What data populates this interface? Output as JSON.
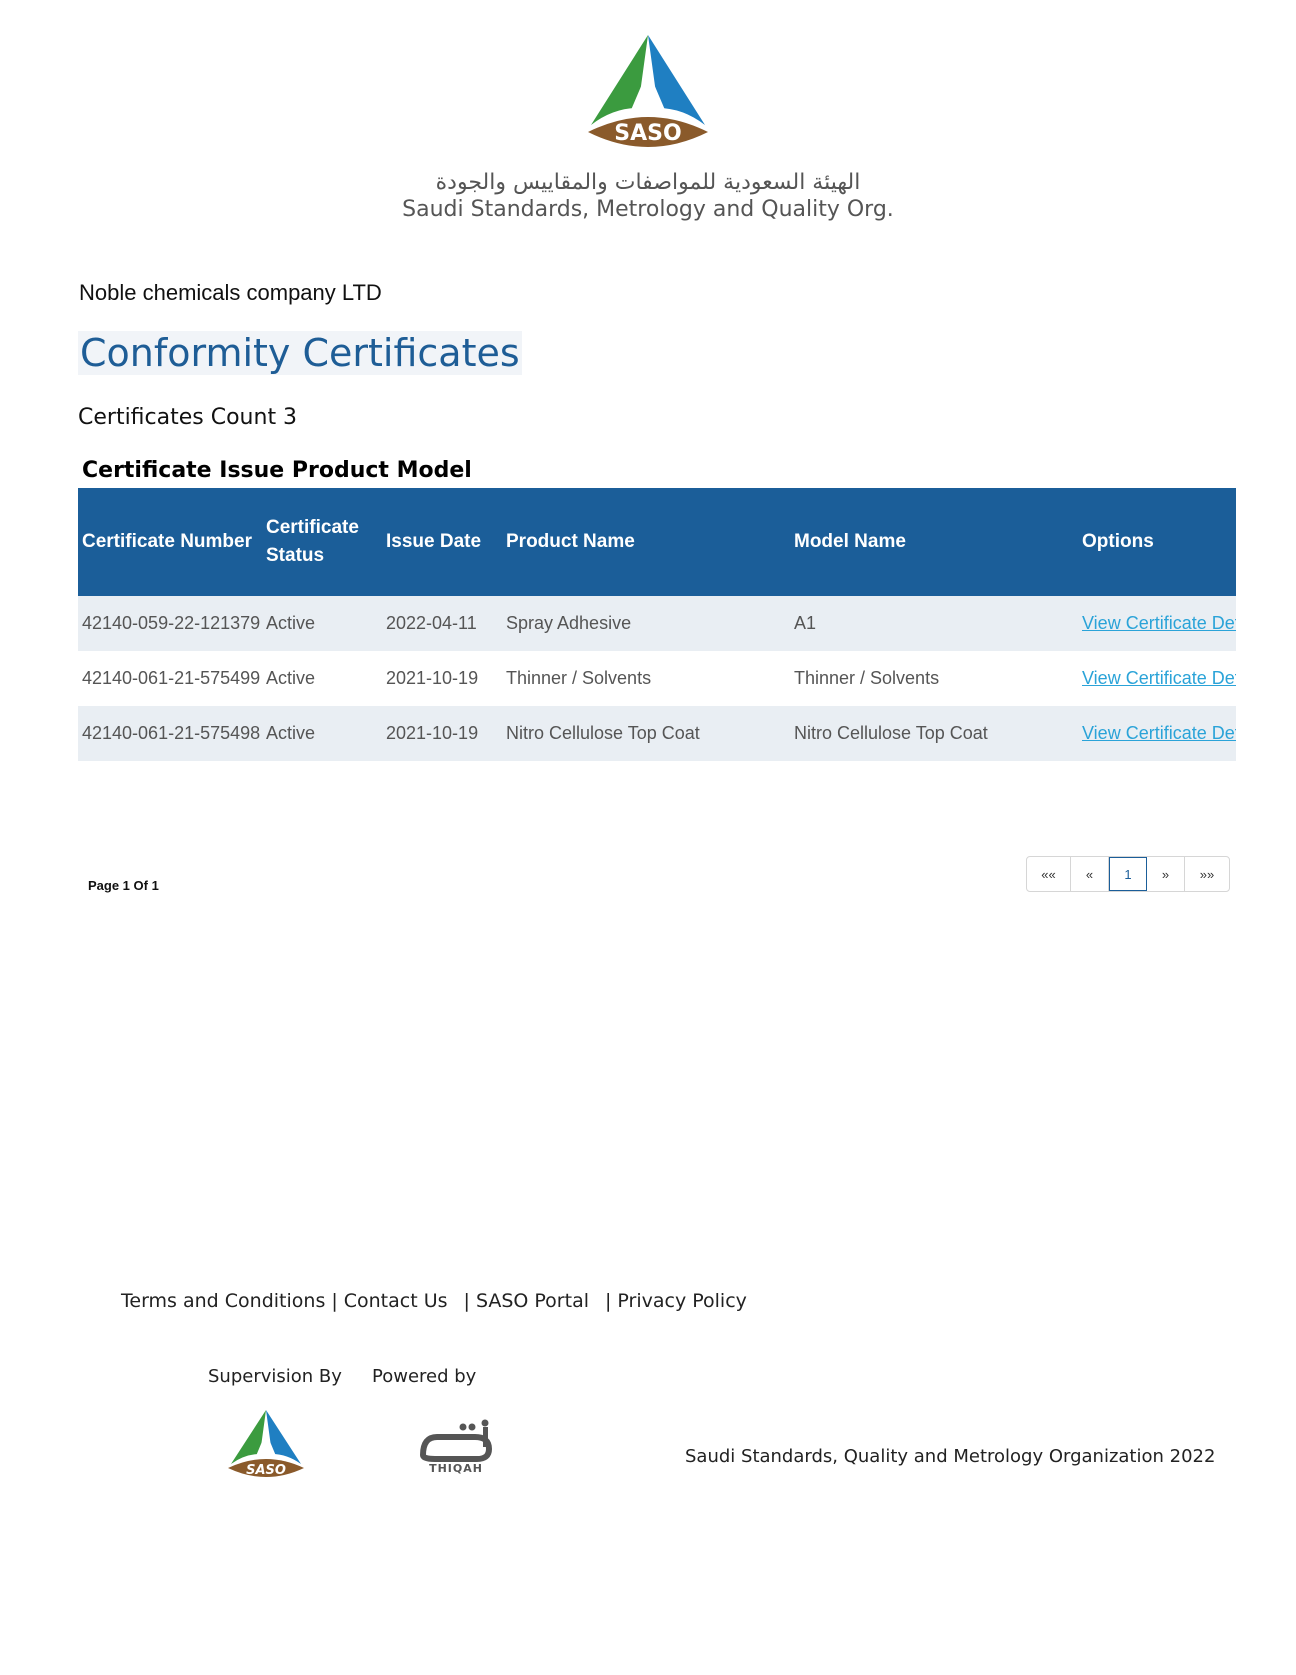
{
  "header": {
    "logo_text": "SASO",
    "org_name_arabic": "الهيئة السعودية للمواصفات والمقاييس والجودة",
    "org_name_english": "Saudi Standards, Metrology and Quality Org."
  },
  "company_name": "Noble chemicals company LTD",
  "page_title": "Conformity Certificates",
  "certificates_count": "Certificates Count 3",
  "table": {
    "caption": "Certificate Issue Product Model",
    "headers": {
      "certificate_number": "Certificate Number",
      "certificate_status": "Certificate Status",
      "issue_date": "Issue Date",
      "product_name": "Product Name",
      "model_name": "Model Name",
      "options": "Options"
    },
    "rows": [
      {
        "certificate_number": "42140-059-22-121379",
        "status": "Active",
        "issue_date": "2022-04-11",
        "product_name": "Spray Adhesive",
        "model_name": "A1",
        "option": "View Certificate Details"
      },
      {
        "certificate_number": "42140-061-21-575499",
        "status": "Active",
        "issue_date": "2021-10-19",
        "product_name": "Thinner / Solvents",
        "model_name": "Thinner / Solvents",
        "option": "View Certificate Details"
      },
      {
        "certificate_number": "42140-061-21-575498",
        "status": "Active",
        "issue_date": "2021-10-19",
        "product_name": "Nitro Cellulose Top Coat",
        "model_name": "Nitro Cellulose Top Coat",
        "option": "View Certificate Details"
      }
    ]
  },
  "pagination": {
    "info": "Page 1 Of 1",
    "first": "««",
    "prev": "«",
    "current": "1",
    "next": "»",
    "last": "»»"
  },
  "footer": {
    "links": {
      "terms": "Terms and Conditions",
      "contact": "Contact Us",
      "portal": "SASO Portal",
      "privacy": "Privacy Policy"
    },
    "separator": "|",
    "supervision_label": "Supervision By",
    "powered_label": "Powered by",
    "small_logo_text": "SASO",
    "thiqah_text": "THIQAH",
    "copyright": "Saudi Standards, Quality and Metrology Organization 2022"
  },
  "colors": {
    "header_blue": "#1b5e99",
    "title_blue": "#1e5d96",
    "link_blue": "#2aa3d8",
    "row_stripe": "#e9eef3"
  }
}
